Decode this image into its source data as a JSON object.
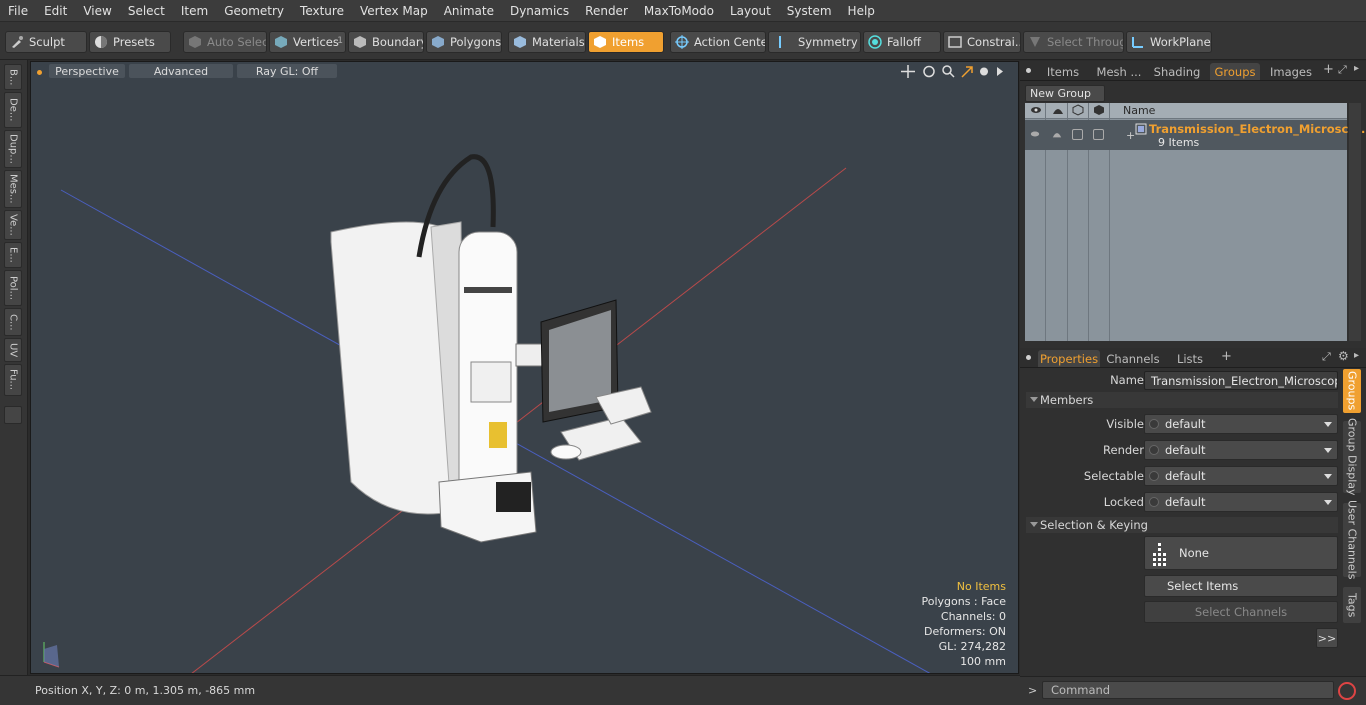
{
  "menu": [
    "File",
    "Edit",
    "View",
    "Select",
    "Item",
    "Geometry",
    "Texture",
    "Vertex Map",
    "Animate",
    "Dynamics",
    "Render",
    "MaxToModo",
    "Layout",
    "System",
    "Help"
  ],
  "toolbar": {
    "sculpt": "Sculpt",
    "presets": "Presets",
    "auto_select": "Auto Select",
    "vertices": "Vertices",
    "vertices_count": "1",
    "boundary": "Boundary",
    "polygons": "Polygons",
    "materials": "Materials",
    "items": "Items",
    "action_center": "Action Center",
    "symmetry": "Symmetry",
    "falloff": "Falloff",
    "constraints": "Constrai...",
    "select_through": "Select Through",
    "workplane": "WorkPlane"
  },
  "left_tabs": [
    "B...",
    "De...",
    "Dup...",
    "Mes...",
    "Ve...",
    "E...",
    "Pol...",
    "C...",
    "UV",
    "Fu..."
  ],
  "viewport": {
    "view_mode": "Perspective",
    "shading": "Advanced",
    "ray_gl": "Ray GL: Off",
    "info": {
      "selection": "No Items",
      "polygons": "Polygons : Face",
      "channels": "Channels: 0",
      "deformers": "Deformers: ON",
      "gl": "GL: 274,282",
      "scale": "100 mm"
    }
  },
  "status": {
    "position": "Position X, Y, Z:   0 m, 1.305 m, -865 mm"
  },
  "top_tabs": [
    "Items",
    "Mesh ...",
    "Shading",
    "Groups",
    "Images"
  ],
  "groups": {
    "new_group": "New Group",
    "header_name": "Name",
    "row": {
      "name": "Transmission_Electron_Microsc ...",
      "count": "9 Items"
    }
  },
  "props_tabs": [
    "Properties",
    "Channels",
    "Lists"
  ],
  "properties": {
    "name_label": "Name",
    "name_value": "Transmission_Electron_Microscope_Wi",
    "members_section": "Members",
    "visible_label": "Visible",
    "visible_value": "default",
    "render_label": "Render",
    "render_value": "default",
    "selectable_label": "Selectable",
    "selectable_value": "default",
    "locked_label": "Locked",
    "locked_value": "default",
    "keying_section": "Selection & Keying",
    "none_label": "None",
    "select_items": "Select Items",
    "select_channels": "Select Channels",
    "more": ">>"
  },
  "right_vtabs": [
    "Groups",
    "Group Display",
    "User Channels",
    "Tags"
  ],
  "command": {
    "prompt": ">",
    "placeholder": "Command"
  },
  "colors": {
    "accent": "#f0a030",
    "viewport_bg": "#3a424a",
    "panel_bg": "#303030"
  }
}
